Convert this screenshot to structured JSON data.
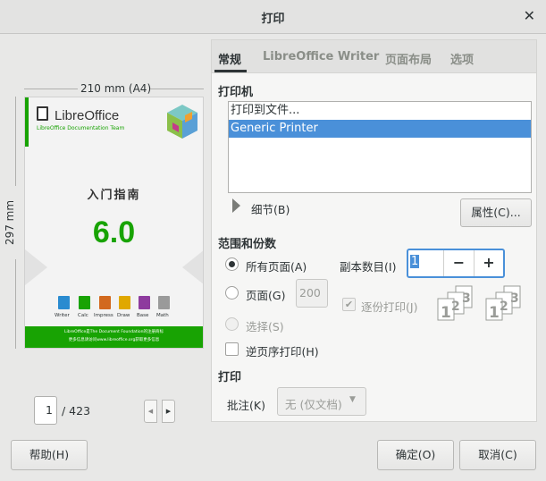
{
  "window": {
    "title": "打印"
  },
  "preview": {
    "width_label": "210 mm (A4)",
    "height_label": "297 mm",
    "doc": {
      "brand": "LibreOffice",
      "brand_sub": "LibreOffice Documentation Team",
      "book_title": "入门指南",
      "version": "6.0",
      "apps": [
        "Writer",
        "Calc",
        "Impress",
        "Draw",
        "Base",
        "Math"
      ],
      "footer_line1": "LibreOffice是The Document Foundation的注册商标",
      "footer_line2": "更多信息请访问www.libreoffice.org获取更多信息"
    },
    "page_current": "1",
    "page_total": "/ 423"
  },
  "tabs": [
    {
      "label": "常规",
      "active": true
    },
    {
      "label": "LibreOffice Writer",
      "active": false
    },
    {
      "label": "页面布局",
      "active": false
    },
    {
      "label": "选项",
      "active": false
    }
  ],
  "printer": {
    "section_label": "打印机",
    "list": [
      {
        "label": "打印到文件...",
        "selected": false
      },
      {
        "label": "Generic Printer",
        "selected": true
      }
    ],
    "details_label": "细节(B)",
    "properties_label": "属性(C)..."
  },
  "range": {
    "section_label": "范围和份数",
    "all_pages_label": "所有页面(A)",
    "pages_label": "页面(G)",
    "pages_value": "200",
    "selection_label": "选择(S)",
    "reverse_label": "逆页序打印(H)",
    "copies_label": "副本数目(I)",
    "copies_value": "1",
    "minus_label": "−",
    "plus_label": "+",
    "collate_label": "逐份打印(J)"
  },
  "print": {
    "section_label": "打印",
    "comments_label": "批注(K)",
    "comments_value": "无 (仅文档)"
  },
  "buttons": {
    "help": "帮助(H)",
    "ok": "确定(O)",
    "cancel": "取消(C)"
  }
}
